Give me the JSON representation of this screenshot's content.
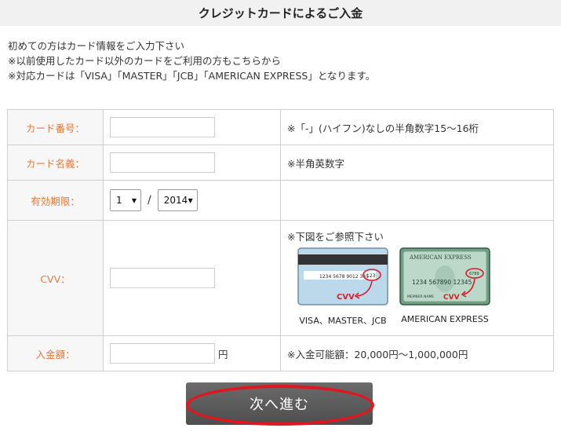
{
  "header": {
    "title": "クレジットカードによるご入金"
  },
  "intro": {
    "lines": [
      "初めての方はカード情報をご入力下さい",
      "※以前使用したカード以外のカードをご利用の方もこちらから",
      "※対応カードは「VISA」「MASTER」「JCB」「AMERICAN EXPRESS」となります。"
    ]
  },
  "form": {
    "card_number": {
      "label": "カード番号：",
      "note": "※「-」(ハイフン)なしの半角数字15～16桁",
      "value": ""
    },
    "card_name": {
      "label": "カード名義：",
      "note": "※半角英数字",
      "value": ""
    },
    "expiry": {
      "label": "有効期限：",
      "month": "1",
      "separator": "/",
      "year": "2014"
    },
    "cvv": {
      "label": "CVV：",
      "note": "※下図をご参照下さい",
      "value": "",
      "card1": {
        "caption": "VISA、MASTER、JCB",
        "number": "1234 5678 9012 345",
        "code": "123",
        "cvv_tag": "CVV"
      },
      "card2": {
        "caption": "AMERICAN EXPRESS",
        "brand": "AMERICAN EXPRESS",
        "number": "1234  567890  12345",
        "code": "6789",
        "holder": "MEMBER  NAME",
        "cvv_tag": "CVV"
      }
    },
    "amount": {
      "label": "入金額：",
      "unit": "円",
      "note": "※入金可能額：20,000円～1,000,000円",
      "value": ""
    }
  },
  "next_button": {
    "label": "次へ進む"
  },
  "colors": {
    "label_accent": "#e8793a",
    "highlight": "#e3151f",
    "button": "#5a5a5a"
  }
}
